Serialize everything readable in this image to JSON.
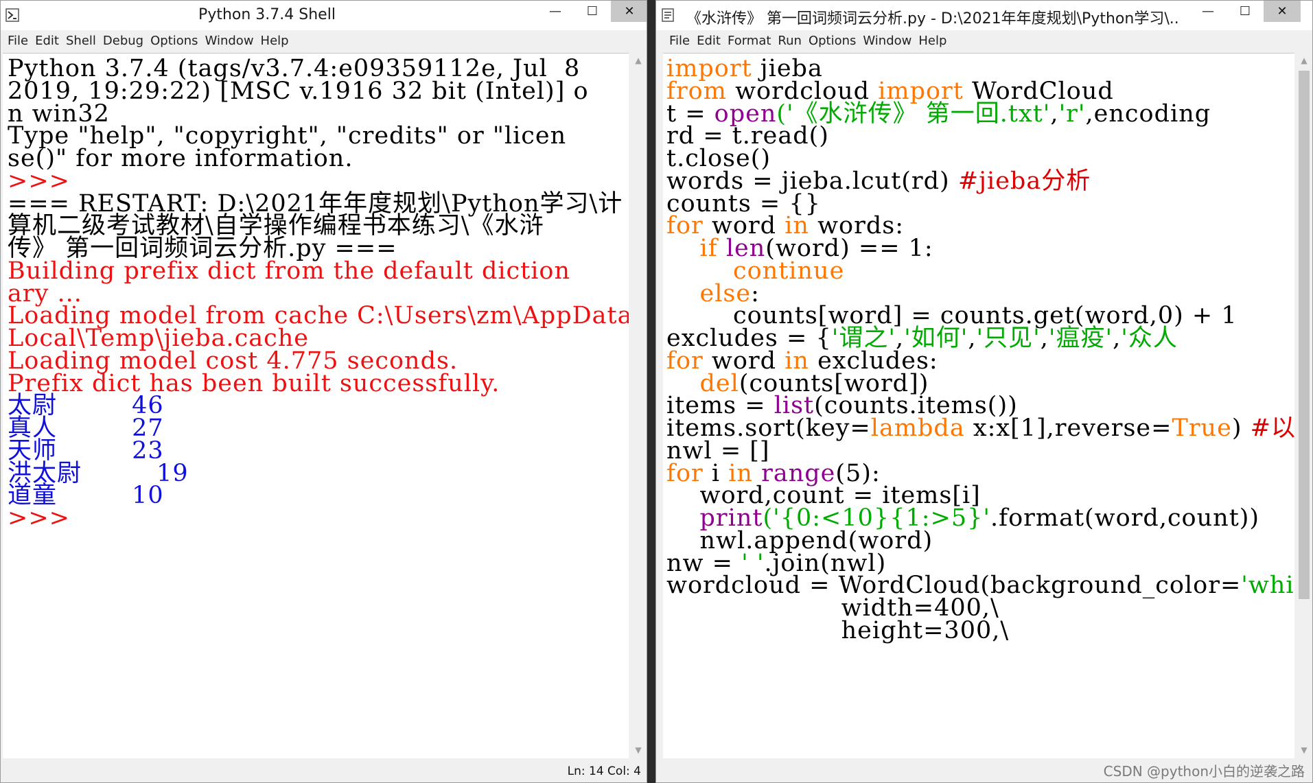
{
  "shell": {
    "title": "Python 3.7.4 Shell",
    "menu": [
      "File",
      "Edit",
      "Shell",
      "Debug",
      "Options",
      "Window",
      "Help"
    ],
    "lines": [
      {
        "text": "Python 3.7.4 (tags/v3.7.4:e09359112e, Jul  8",
        "color": "blk"
      },
      {
        "text": "2019, 19:29:22) [MSC v.1916 32 bit (Intel)] o",
        "color": "blk"
      },
      {
        "text": "n win32",
        "color": "blk"
      },
      {
        "text": "Type \"help\", \"copyright\", \"credits\" or \"licen",
        "color": "blk"
      },
      {
        "text": "se()\" for more information.",
        "color": "blk"
      },
      {
        "text": ">>>",
        "color": "red"
      },
      {
        "text": "=== RESTART: D:\\2021年年度规划\\Python学习\\计",
        "color": "blk"
      },
      {
        "text": "算机二级考试教材\\自学操作编程书本练习\\《水浒",
        "color": "blk"
      },
      {
        "text": "传》 第一回词频词云分析.py ===",
        "color": "blk"
      },
      {
        "text": "Building prefix dict from the default diction",
        "color": "red"
      },
      {
        "text": "ary ...",
        "color": "red"
      },
      {
        "text": "Loading model from cache C:\\Users\\zm\\AppData\\",
        "color": "red"
      },
      {
        "text": "Local\\Temp\\jieba.cache",
        "color": "red"
      },
      {
        "text": "Loading model cost 4.775 seconds.",
        "color": "red"
      },
      {
        "text": "Prefix dict has been built successfully.",
        "color": "red"
      },
      {
        "text": "太尉         46",
        "color": "blue"
      },
      {
        "text": "真人         27",
        "color": "blue"
      },
      {
        "text": "天师         23",
        "color": "blue"
      },
      {
        "text": "洪太尉         19",
        "color": "blue"
      },
      {
        "text": "道童         10",
        "color": "blue"
      },
      {
        "text": ">>>",
        "color": "red"
      }
    ],
    "status": "Ln: 14  Col: 4"
  },
  "editor": {
    "title": "《水浒传》 第一回词频词云分析.py - D:\\2021年年度规划\\Python学习\\...",
    "menu": [
      "File",
      "Edit",
      "Format",
      "Run",
      "Options",
      "Window",
      "Help"
    ],
    "lines": [
      [
        [
          "import",
          "kw"
        ],
        [
          " jieba",
          "blk"
        ]
      ],
      [
        [
          "from",
          "kw"
        ],
        [
          " wordcloud ",
          "blk"
        ],
        [
          "import",
          "kw"
        ],
        [
          " WordCloud",
          "blk"
        ]
      ],
      [
        [
          "t = ",
          "blk"
        ],
        [
          "open",
          "bi"
        ],
        [
          "('《水浒传》 第一回.txt'",
          "str"
        ],
        [
          ",",
          "blk"
        ],
        [
          "'r'",
          "str"
        ],
        [
          ",encoding",
          "blk"
        ]
      ],
      [
        [
          "rd = t.read()",
          "blk"
        ]
      ],
      [
        [
          "t.close()",
          "blk"
        ]
      ],
      [
        [
          "words = jieba.lcut(rd) ",
          "blk"
        ],
        [
          "#jieba分析",
          "cmt"
        ]
      ],
      [
        [
          "counts = {}",
          "blk"
        ]
      ],
      [
        [
          "for",
          "kw"
        ],
        [
          " word ",
          "blk"
        ],
        [
          "in",
          "kw"
        ],
        [
          " words:",
          "blk"
        ]
      ],
      [
        [
          "    ",
          "blk"
        ],
        [
          "if",
          "kw"
        ],
        [
          " ",
          "blk"
        ],
        [
          "len",
          "bi"
        ],
        [
          "(word) == 1:",
          "blk"
        ]
      ],
      [
        [
          "        ",
          "blk"
        ],
        [
          "continue",
          "kw"
        ]
      ],
      [
        [
          "    ",
          "blk"
        ],
        [
          "else",
          "kw"
        ],
        [
          ":",
          "blk"
        ]
      ],
      [
        [
          "        counts[word] = counts.get(word,0) + 1",
          "blk"
        ]
      ],
      [
        [
          "excludes = {",
          "blk"
        ],
        [
          "'谓之'",
          "str"
        ],
        [
          ",",
          "blk"
        ],
        [
          "'如何'",
          "str"
        ],
        [
          ",",
          "blk"
        ],
        [
          "'只见'",
          "str"
        ],
        [
          ",",
          "blk"
        ],
        [
          "'瘟疫'",
          "str"
        ],
        [
          ",",
          "blk"
        ],
        [
          "'众人",
          "str"
        ]
      ],
      [
        [
          "for",
          "kw"
        ],
        [
          " word ",
          "blk"
        ],
        [
          "in",
          "kw"
        ],
        [
          " excludes:",
          "blk"
        ]
      ],
      [
        [
          "    ",
          "blk"
        ],
        [
          "del",
          "kw"
        ],
        [
          "(counts[word])",
          "blk"
        ]
      ],
      [
        [
          "items = ",
          "blk"
        ],
        [
          "list",
          "bi"
        ],
        [
          "(counts.items())",
          "blk"
        ]
      ],
      [
        [
          "items.sort(key=",
          "blk"
        ],
        [
          "lambda",
          "kw"
        ],
        [
          " x:x[1],reverse=",
          "blk"
        ],
        [
          "True",
          "kw"
        ],
        [
          ") ",
          "blk"
        ],
        [
          "#以",
          "cmt"
        ]
      ],
      [
        [
          "nwl = []",
          "blk"
        ]
      ],
      [
        [
          "for",
          "kw"
        ],
        [
          " i ",
          "blk"
        ],
        [
          "in",
          "kw"
        ],
        [
          " ",
          "blk"
        ],
        [
          "range",
          "bi"
        ],
        [
          "(5):",
          "blk"
        ]
      ],
      [
        [
          "    word,count = items[i]",
          "blk"
        ]
      ],
      [
        [
          "    ",
          "blk"
        ],
        [
          "print",
          "bi"
        ],
        [
          "('{0:<10}{1:>5}'",
          "str"
        ],
        [
          ".format(word,count))",
          "blk"
        ]
      ],
      [
        [
          "    nwl.append(word)",
          "blk"
        ]
      ],
      [
        [
          "nw = ",
          "blk"
        ],
        [
          "' '",
          "str"
        ],
        [
          ".join(nwl)",
          "blk"
        ]
      ],
      [
        [
          "wordcloud = WordCloud(background_color=",
          "blk"
        ],
        [
          "'white",
          "str"
        ]
      ],
      [
        [
          "                     width=400,\\",
          "blk"
        ]
      ],
      [
        [
          "                     height=300,\\",
          "blk"
        ]
      ]
    ]
  },
  "watermark": "CSDN @python小白的逆袭之路",
  "window_controls": {
    "minimize": "—",
    "maximize": "☐",
    "close": "✕"
  }
}
